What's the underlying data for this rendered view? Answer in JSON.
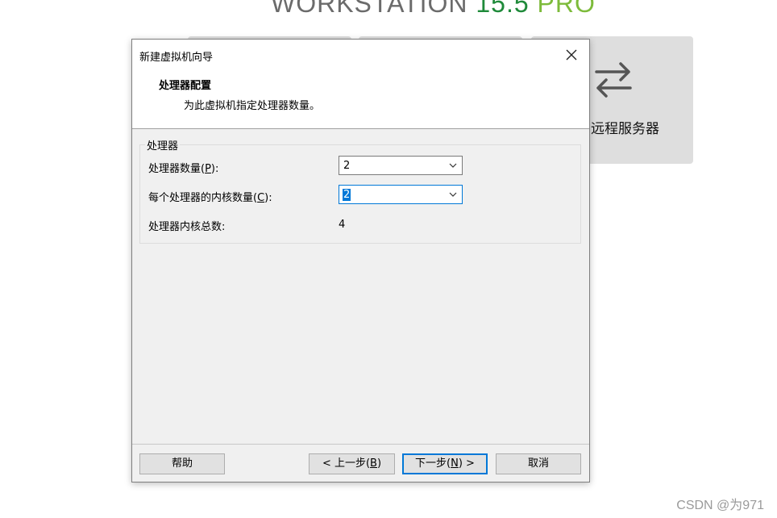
{
  "background": {
    "brand": {
      "word": "WORKSTATION",
      "version": "15.5",
      "edition": "PRO"
    },
    "remote_card": {
      "label": "远程服务器",
      "icon": "swap-arrows-icon"
    },
    "watermark": "CSDN @为971"
  },
  "dialog": {
    "title": "新建虚拟机向导",
    "header": {
      "title": "处理器配置",
      "subtitle": "为此虚拟机指定处理器数量。"
    },
    "group": {
      "label": "处理器",
      "processor_count": {
        "label_pre": "处理器数量(",
        "key": "P",
        "label_post": "):",
        "value": "2"
      },
      "cores_per_processor": {
        "label_pre": "每个处理器的内核数量(",
        "key": "C",
        "label_post": "):",
        "value": "2"
      },
      "total_cores": {
        "label": "处理器内核总数:",
        "value": "4"
      }
    },
    "buttons": {
      "help": "帮助",
      "back": {
        "pre": "< 上一步(",
        "key": "B",
        "post": ")"
      },
      "next": {
        "pre": "下一步(",
        "key": "N",
        "post": ") >"
      },
      "cancel": "取消"
    }
  },
  "colors": {
    "accent": "#0078d7",
    "brand_green": "#1f8a3a",
    "pro_green": "#7dbb3b"
  }
}
